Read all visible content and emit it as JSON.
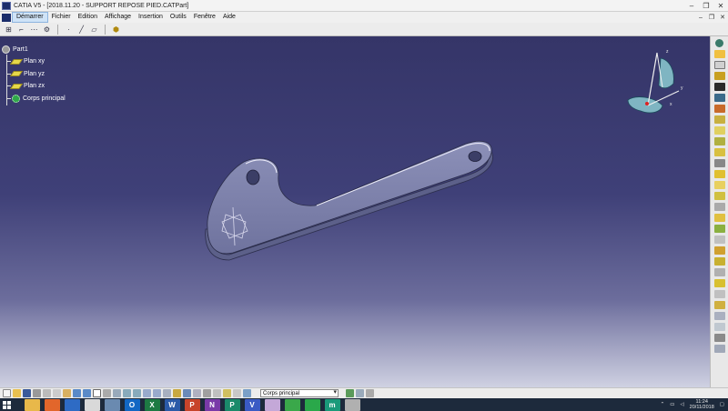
{
  "window": {
    "title": "CATIA V5 - [2018.11.20 - SUPPORT REPOSE PIED.CATPart]"
  },
  "menu": {
    "items": [
      {
        "label": "Démarrer",
        "active": true
      },
      {
        "label": "Fichier"
      },
      {
        "label": "Edition"
      },
      {
        "label": "Affichage"
      },
      {
        "label": "Insertion"
      },
      {
        "label": "Outils"
      },
      {
        "label": "Fenêtre"
      },
      {
        "label": "Aide"
      }
    ]
  },
  "tree": {
    "root": "Part1",
    "nodes": [
      {
        "label": "Plan xy",
        "icon": "plane-icon"
      },
      {
        "label": "Plan yz",
        "icon": "plane-icon"
      },
      {
        "label": "Plan zx",
        "icon": "plane-icon"
      },
      {
        "label": "Corps principal",
        "icon": "body-icon"
      }
    ]
  },
  "compass": {
    "x_label": "x",
    "y_label": "y",
    "z_label": "z"
  },
  "bottom_toolbar": {
    "current_body": "Corps principal"
  },
  "taskbar": {
    "apps": [
      {
        "name": "explorer-taskbar-icon",
        "color": "#e8b84a",
        "glyph": ""
      },
      {
        "name": "firefox-taskbar-icon",
        "color": "#e2662b",
        "glyph": ""
      },
      {
        "name": "windows-taskbar-icon",
        "color": "#2e6bc4",
        "glyph": ""
      },
      {
        "name": "chrome-taskbar-icon",
        "color": "#d9d9d9",
        "glyph": ""
      },
      {
        "name": "app-taskbar-icon",
        "color": "#6a8ab0",
        "glyph": ""
      },
      {
        "name": "outlook-taskbar-icon",
        "color": "#1267c4",
        "glyph": "O"
      },
      {
        "name": "excel-taskbar-icon",
        "color": "#1d7a43",
        "glyph": "X"
      },
      {
        "name": "word-taskbar-icon",
        "color": "#2b5aa8",
        "glyph": "W"
      },
      {
        "name": "powerpoint-taskbar-icon",
        "color": "#c7442a",
        "glyph": "P"
      },
      {
        "name": "onenote-taskbar-icon",
        "color": "#7a3aa8",
        "glyph": "N"
      },
      {
        "name": "publisher-taskbar-icon",
        "color": "#1a8a6a",
        "glyph": "P"
      },
      {
        "name": "visio-taskbar-icon",
        "color": "#3a5ac4",
        "glyph": "V"
      },
      {
        "name": "paint-taskbar-icon",
        "color": "#c4a8d8",
        "glyph": ""
      },
      {
        "name": "tool-taskbar-icon",
        "color": "#3aa84a",
        "glyph": ""
      },
      {
        "name": "evernote-taskbar-icon",
        "color": "#2aa84a",
        "glyph": ""
      },
      {
        "name": "m-app-taskbar-icon",
        "color": "#1a9a7a",
        "glyph": "m"
      },
      {
        "name": "catia-taskbar-icon",
        "color": "#b0b0b0",
        "glyph": ""
      }
    ],
    "time": "11:24",
    "date": "20/11/2018"
  },
  "colors": {
    "background_top": "#353568",
    "background_bottom": "#cfd1e2",
    "part_fill": "#7a7ea8",
    "part_top": "#9ea2c6"
  }
}
